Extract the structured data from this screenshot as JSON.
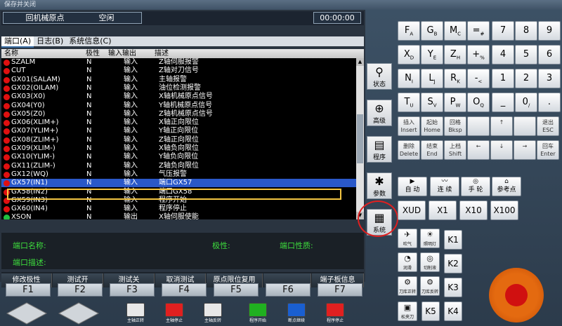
{
  "window": {
    "title": "保存并关闭"
  },
  "status": {
    "mode": "回机械原点",
    "state": "空闲",
    "time": "00:00:00"
  },
  "tabs": [
    {
      "label": "端口(A)"
    },
    {
      "label": "日志(B)"
    },
    {
      "label": "系统信息(C)"
    }
  ],
  "table": {
    "columns": [
      "名称",
      "极性",
      "输入输出",
      "描述"
    ],
    "rows": [
      {
        "name": "SZALM",
        "pol": "N",
        "io": "输入",
        "desc": "Z轴伺服报警",
        "led": "red"
      },
      {
        "name": "CUT",
        "pol": "N",
        "io": "输入",
        "desc": "Z轴对刀信号",
        "led": "red"
      },
      {
        "name": "GX01(SALAM)",
        "pol": "N",
        "io": "输入",
        "desc": "主轴报警",
        "led": "red"
      },
      {
        "name": "GX02(OILAM)",
        "pol": "N",
        "io": "输入",
        "desc": "油位检测报警",
        "led": "red"
      },
      {
        "name": "GX03(X0)",
        "pol": "N",
        "io": "输入",
        "desc": "X轴机械原点信号",
        "led": "red"
      },
      {
        "name": "GX04(Y0)",
        "pol": "N",
        "io": "输入",
        "desc": "Y轴机械原点信号",
        "led": "red"
      },
      {
        "name": "GX05(Z0)",
        "pol": "N",
        "io": "输入",
        "desc": "Z轴机械原点信号",
        "led": "red"
      },
      {
        "name": "GX06(XLIM+)",
        "pol": "N",
        "io": "输入",
        "desc": "X轴正向限位",
        "led": "red"
      },
      {
        "name": "GX07(YLIM+)",
        "pol": "N",
        "io": "输入",
        "desc": "Y轴正向限位",
        "led": "red"
      },
      {
        "name": "GX08(ZLIM+)",
        "pol": "N",
        "io": "输入",
        "desc": "Z轴正向限位",
        "led": "red"
      },
      {
        "name": "GX09(XLIM-)",
        "pol": "N",
        "io": "输入",
        "desc": "X轴负向限位",
        "led": "red"
      },
      {
        "name": "GX10(YLIM-)",
        "pol": "N",
        "io": "输入",
        "desc": "Y轴负向限位",
        "led": "red"
      },
      {
        "name": "GX11(ZLIM-)",
        "pol": "N",
        "io": "输入",
        "desc": "Z轴负向限位",
        "led": "red"
      },
      {
        "name": "GX12(WQ)",
        "pol": "N",
        "io": "输入",
        "desc": "气压报警",
        "led": "red"
      },
      {
        "name": "GX57(IN1)",
        "pol": "N",
        "io": "输入",
        "desc": "端口GX57",
        "led": "red",
        "selected": true
      },
      {
        "name": "GX58(IN2)",
        "pol": "N",
        "io": "输入",
        "desc": "端口GX58",
        "led": "red"
      },
      {
        "name": "GX59(IN3)",
        "pol": "N",
        "io": "输入",
        "desc": "程序开始",
        "led": "red"
      },
      {
        "name": "GX60(IN4)",
        "pol": "N",
        "io": "输入",
        "desc": "程序停止",
        "led": "red"
      },
      {
        "name": "XSON",
        "pol": "N",
        "io": "输出",
        "desc": "X轴伺服使能",
        "led": "green"
      }
    ]
  },
  "info": {
    "port_name_label": "端口名称:",
    "polarity_label": "极性:",
    "port_type_label": "端口性质:",
    "port_desc_label": "端口描述:"
  },
  "softkeys": [
    "修改极性",
    "测试开",
    "测试关",
    "取消测试",
    "原点限位复用",
    "",
    "端子板信息"
  ],
  "fkeys": [
    "F1",
    "F2",
    "F3",
    "F4",
    "F5",
    "F6",
    "F7"
  ],
  "bottom_buttons": [
    {
      "label": "主轴正转",
      "color": "#e8e8e8",
      "icon": "spindle-cw-icon"
    },
    {
      "label": "主轴停止",
      "color": "#e02020",
      "icon": "spindle-stop-icon"
    },
    {
      "label": "主轴反转",
      "color": "#e8e8e8",
      "icon": "spindle-ccw-icon"
    },
    {
      "label": "程序开始",
      "color": "#20b020",
      "icon": "program-start-icon"
    },
    {
      "label": "断点继续",
      "color": "#1a5fd0",
      "icon": "breakpoint-continue-icon"
    },
    {
      "label": "程序停止",
      "color": "#e02020",
      "icon": "program-stop-icon"
    }
  ],
  "side_buttons": [
    {
      "label": "状态",
      "icon": "spindle-icon"
    },
    {
      "label": "高级",
      "icon": "crosshair-icon"
    },
    {
      "label": "程序",
      "icon": "document-icon"
    },
    {
      "label": "参数",
      "icon": "gear-icon"
    },
    {
      "label": "系统",
      "icon": "panel-icon"
    }
  ],
  "keypad": [
    [
      "F",
      "A",
      "G",
      "B",
      "M",
      "C",
      "=",
      "#",
      "7",
      "8",
      "9"
    ],
    [
      "X",
      "D",
      "Y",
      "E",
      "Z",
      "H",
      "+",
      "%",
      "4",
      "5",
      "6"
    ],
    [
      "N",
      "I",
      "L",
      "J",
      "R",
      "K",
      "-",
      "<",
      "1",
      "2",
      "3"
    ],
    [
      "T",
      "U",
      "S",
      "V",
      "P",
      "W",
      "O",
      "Q",
      "_",
      "0",
      "/",
      "."
    ]
  ],
  "edit_keys": [
    {
      "label": "插入",
      "sub": "Insert"
    },
    {
      "label": "起始",
      "sub": "Home"
    },
    {
      "label": "回格",
      "sub": "Bksp"
    },
    {
      "label": "",
      "sub": ""
    },
    {
      "label": "↑",
      "sub": ""
    },
    {
      "label": "",
      "sub": ""
    },
    {
      "label": "退出",
      "sub": "ESC"
    },
    {
      "label": "删除",
      "sub": "Delete"
    },
    {
      "label": "结束",
      "sub": "End"
    },
    {
      "label": "上档",
      "sub": "Shift"
    },
    {
      "label": "←",
      "sub": ""
    },
    {
      "label": "↓",
      "sub": ""
    },
    {
      "label": "→",
      "sub": ""
    },
    {
      "label": "回车",
      "sub": "Enter"
    }
  ],
  "modes": [
    {
      "label": "自 动"
    },
    {
      "label": "连 续"
    },
    {
      "label": "手 轮"
    },
    {
      "label": "参考点"
    }
  ],
  "axis_buttons": [
    "XUD",
    "X1",
    "X10",
    "X100"
  ],
  "aux_keys": [
    {
      "label": "吹气",
      "icon": "blow-icon"
    },
    {
      "label": "照明灯",
      "icon": "lamp-icon"
    },
    {
      "label": "润滑",
      "icon": "lube-icon"
    },
    {
      "label": "切削液",
      "icon": "coolant-icon"
    },
    {
      "label": "刀库正转",
      "icon": "tool-cw-icon"
    },
    {
      "label": "刀库反转",
      "icon": "tool-ccw-icon"
    },
    {
      "label": "松夹刀",
      "icon": "clamp-icon"
    }
  ],
  "k_buttons": [
    "K1",
    "K2",
    "K3",
    "K4",
    "K5"
  ]
}
